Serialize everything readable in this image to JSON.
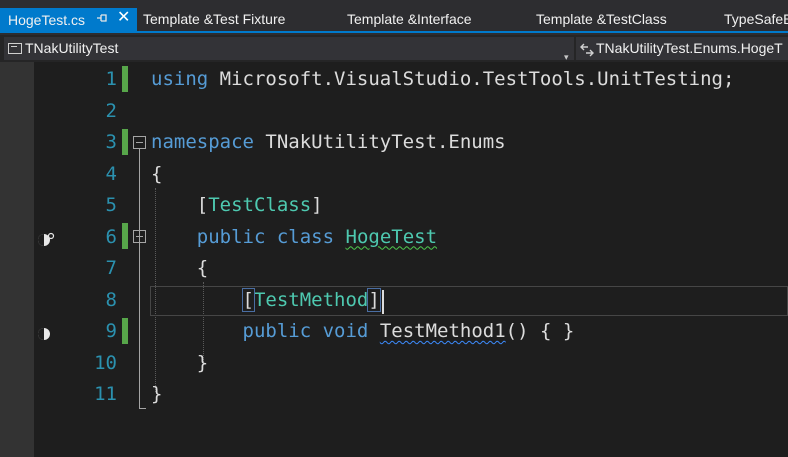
{
  "tabs": [
    {
      "label": "HogeTest.cs",
      "active": true,
      "pin_icon": "pin-icon",
      "close_glyph": "✕"
    },
    {
      "label": "Template &Test Fixture"
    },
    {
      "label": "Template &Interface"
    },
    {
      "label": "Template &TestClass"
    },
    {
      "label": "TypeSafeE"
    }
  ],
  "navbar": {
    "project": "TNakUtilityTest",
    "member": "TNakUtilityTest.Enums.HogeT",
    "dropdown_glyph": "▾"
  },
  "editor": {
    "lines": [
      {
        "number": "1",
        "tokens": [
          {
            "t": "using",
            "c": "kw"
          },
          {
            "t": " Microsoft.VisualStudio.TestTools.UnitTesting;",
            "c": "pl"
          }
        ]
      },
      {
        "number": "2",
        "tokens": []
      },
      {
        "number": "3",
        "tokens": [
          {
            "t": "namespace",
            "c": "kw"
          },
          {
            "t": " TNakUtilityTest.Enums",
            "c": "pl"
          }
        ]
      },
      {
        "number": "4",
        "tokens": [
          {
            "t": "{",
            "c": "pl"
          }
        ]
      },
      {
        "number": "5",
        "tokens": [
          {
            "t": "    [",
            "c": "pl"
          },
          {
            "t": "TestClass",
            "c": "ty"
          },
          {
            "t": "]",
            "c": "pl"
          }
        ]
      },
      {
        "number": "6",
        "tokens": [
          {
            "t": "    ",
            "c": "pl"
          },
          {
            "t": "public",
            "c": "kw"
          },
          {
            "t": " ",
            "c": "pl"
          },
          {
            "t": "class",
            "c": "kw"
          },
          {
            "t": " ",
            "c": "pl"
          },
          {
            "t": "HogeTest",
            "c": "ty squig-g"
          }
        ]
      },
      {
        "number": "7",
        "tokens": [
          {
            "t": "    {",
            "c": "pl"
          }
        ]
      },
      {
        "number": "8",
        "tokens": [
          {
            "t": "        ",
            "c": "pl"
          },
          {
            "t": "[",
            "c": "pl bracket-hl"
          },
          {
            "t": "TestMethod",
            "c": "ty"
          },
          {
            "t": "]",
            "c": "pl bracket-hl"
          }
        ]
      },
      {
        "number": "9",
        "tokens": [
          {
            "t": "        ",
            "c": "pl"
          },
          {
            "t": "public",
            "c": "kw"
          },
          {
            "t": " ",
            "c": "pl"
          },
          {
            "t": "void",
            "c": "kw"
          },
          {
            "t": " ",
            "c": "pl"
          },
          {
            "t": "TestMethod1",
            "c": "pl squig-b"
          },
          {
            "t": "() { }",
            "c": "pl"
          }
        ]
      },
      {
        "number": "10",
        "tokens": [
          {
            "t": "    }",
            "c": "pl"
          }
        ]
      },
      {
        "number": "11",
        "tokens": [
          {
            "t": "}",
            "c": "pl"
          }
        ]
      }
    ],
    "glyphs": [
      {
        "line": "6",
        "icon": "test-class-status-icon"
      },
      {
        "line": "9",
        "icon": "test-method-status-icon"
      }
    ]
  },
  "colors": {
    "accent": "#007acc",
    "keyword": "#569cd6",
    "type": "#4ec9b0",
    "line_number": "#2b91af",
    "change_bar": "#57a64a"
  }
}
